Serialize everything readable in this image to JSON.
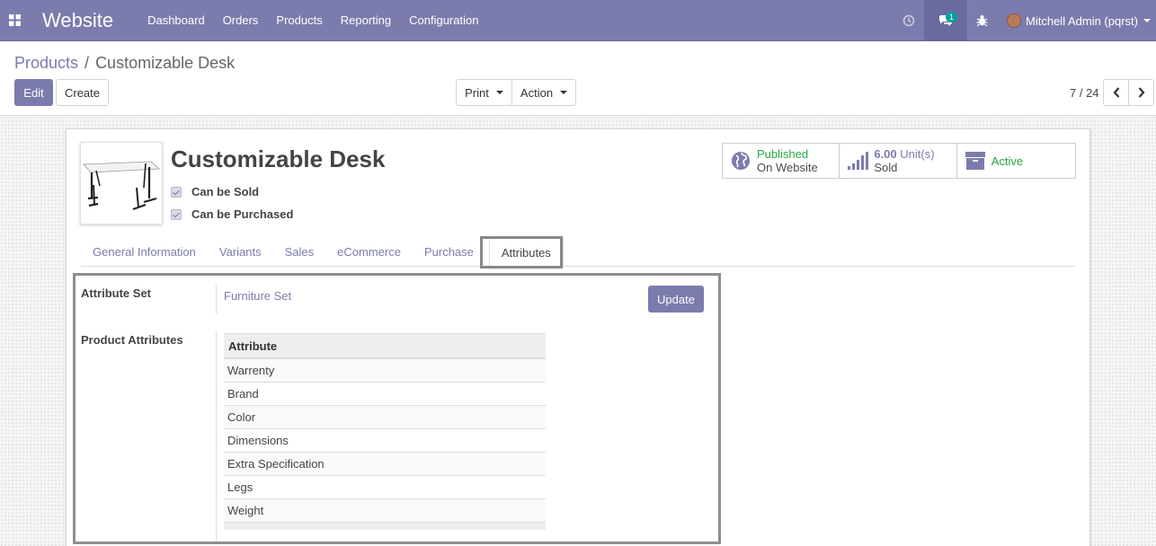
{
  "navbar": {
    "brand": "Website",
    "menu": [
      "Dashboard",
      "Orders",
      "Products",
      "Reporting",
      "Configuration"
    ],
    "chat_badge": "1",
    "user_name": "Mitchell Admin (pqrst)"
  },
  "breadcrumb": {
    "parent": "Products",
    "separator": "/",
    "current": "Customizable Desk"
  },
  "toolbar": {
    "edit_label": "Edit",
    "create_label": "Create",
    "print_label": "Print",
    "action_label": "Action"
  },
  "pager": {
    "value": "7 / 24"
  },
  "product": {
    "name": "Customizable Desk",
    "can_be_sold": "Can be Sold",
    "can_be_purchased": "Can be Purchased"
  },
  "smart_buttons": {
    "published_title": "Published",
    "published_sub": "On Website",
    "sold_value": "6.00",
    "sold_unit": "Unit(s)",
    "sold_sub": "Sold",
    "active_label": "Active"
  },
  "tabs": [
    "General Information",
    "Variants",
    "Sales",
    "eCommerce",
    "Purchase",
    "Attributes"
  ],
  "attributes_tab": {
    "attribute_set_label": "Attribute Set",
    "attribute_set_value": "Furniture Set",
    "update_label": "Update",
    "product_attributes_label": "Product Attributes",
    "table_header": "Attribute",
    "rows": [
      "Warrenty",
      "Brand",
      "Color",
      "Dimensions",
      "Extra Specification",
      "Legs",
      "Weight"
    ]
  },
  "colors": {
    "brand": "#7c7bad",
    "published": "#28a745"
  }
}
